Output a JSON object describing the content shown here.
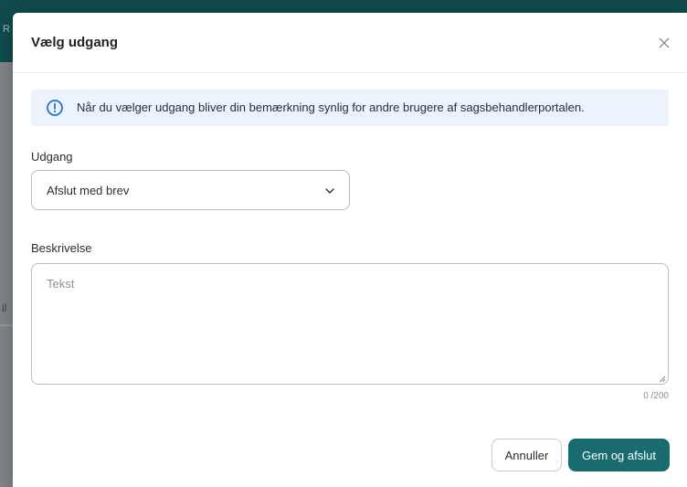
{
  "background": {
    "fragment_top": "R",
    "fragment_mid": "il"
  },
  "dialog": {
    "title": "Vælg udgang",
    "close_icon": "close-icon",
    "info": {
      "icon": "info-circle-icon",
      "text": "Når du vælger udgang bliver din bemærkning synlig for andre brugere af sagsbehandlerportalen."
    },
    "outcome": {
      "label": "Udgang",
      "selected": "Afslut med brev"
    },
    "description": {
      "label": "Beskrivelse",
      "placeholder": "Tekst",
      "value": "",
      "counter": "0 /200"
    },
    "buttons": {
      "cancel": "Annuller",
      "submit": "Gem og afslut"
    }
  },
  "colors": {
    "primary": "#1a6b70",
    "header_bg": "#0f4a4c",
    "info_bg": "#ecf3fc",
    "info_icon": "#2b6fd6"
  }
}
